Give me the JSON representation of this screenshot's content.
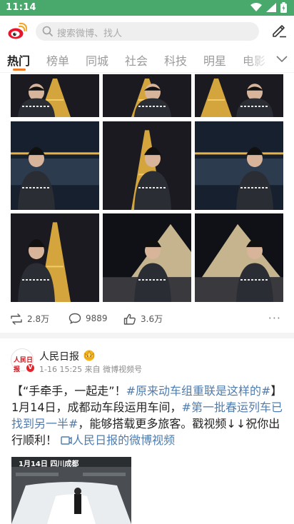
{
  "status_bar": {
    "time": "11:14"
  },
  "search": {
    "placeholder": "搜索微博、找人"
  },
  "tabs": [
    {
      "label": "热门",
      "active": true
    },
    {
      "label": "榜单"
    },
    {
      "label": "同城"
    },
    {
      "label": "社会"
    },
    {
      "label": "科技"
    },
    {
      "label": "明星"
    },
    {
      "label": "电影"
    }
  ],
  "post1": {
    "photo_icons": [
      "eiffel-photo",
      "eiffel-photo",
      "eiffel-photo",
      "seine-photo",
      "eiffel-photo",
      "seine-photo",
      "eiffel-photo",
      "louvre-photo",
      "louvre-photo"
    ],
    "reposts": "2.8万",
    "comments": "9889",
    "likes": "3.6万"
  },
  "post2": {
    "author": "人民日报",
    "avatar_text": "人民日报",
    "meta": "1-16 15:25 来自 微博视频号",
    "text_parts": {
      "p1": "【“手牵手，一起走”！",
      "tag1": "#原来动车组重联是这样的#",
      "p2": "】1月14日，成都动车段运用车间，",
      "tag2": "#第一批春运列车已找到另一半#",
      "p3": "，能够搭载更多旅客。戳视频↓↓祝你出行顺利！",
      "link": "人民日报的微博视频"
    },
    "video_caption": "1月14日 四川成都"
  },
  "colors": {
    "status_bar": "#49a86c",
    "accent": "#f07b24",
    "link": "#507daf"
  }
}
